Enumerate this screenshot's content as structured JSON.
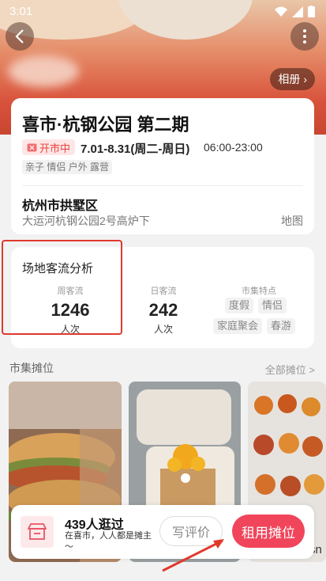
{
  "status_bar": {
    "time": "3:01"
  },
  "header": {
    "back_icon": "back-arrow-icon",
    "more_icon": "more-vertical-icon",
    "album_label": "相册"
  },
  "event": {
    "title": "喜市·杭钢公园 第二期",
    "status_badge": "开市中",
    "dates": "7.01-8.31(周二-周日)",
    "hours": "06:00-23:00",
    "tags": "亲子 情侣 户外 露营",
    "district": "杭州市拱墅区",
    "address": "大运河杭钢公园2号高炉下",
    "map_link": "地图"
  },
  "traffic": {
    "title": "场地客流分析",
    "weekly": {
      "label": "周客流",
      "value": "1246",
      "unit": "人次"
    },
    "daily": {
      "label": "日客流",
      "value": "242",
      "unit": "人次"
    },
    "features": {
      "label": "市集特点",
      "chips": [
        "度假",
        "情侣",
        "家庭聚会",
        "春游"
      ]
    }
  },
  "stalls": {
    "section_title": "市集摊位",
    "all_link": "全部摊位 >",
    "partial_text": "sn"
  },
  "bottom_bar": {
    "visited": "439人逛过",
    "slogan": "在喜市，人人都是摊主～",
    "review_label": "写评价",
    "rent_label": "租用摊位"
  },
  "colors": {
    "accent": "#f0455b",
    "highlight": "#e0392c",
    "badge_red": "#e8413b"
  }
}
